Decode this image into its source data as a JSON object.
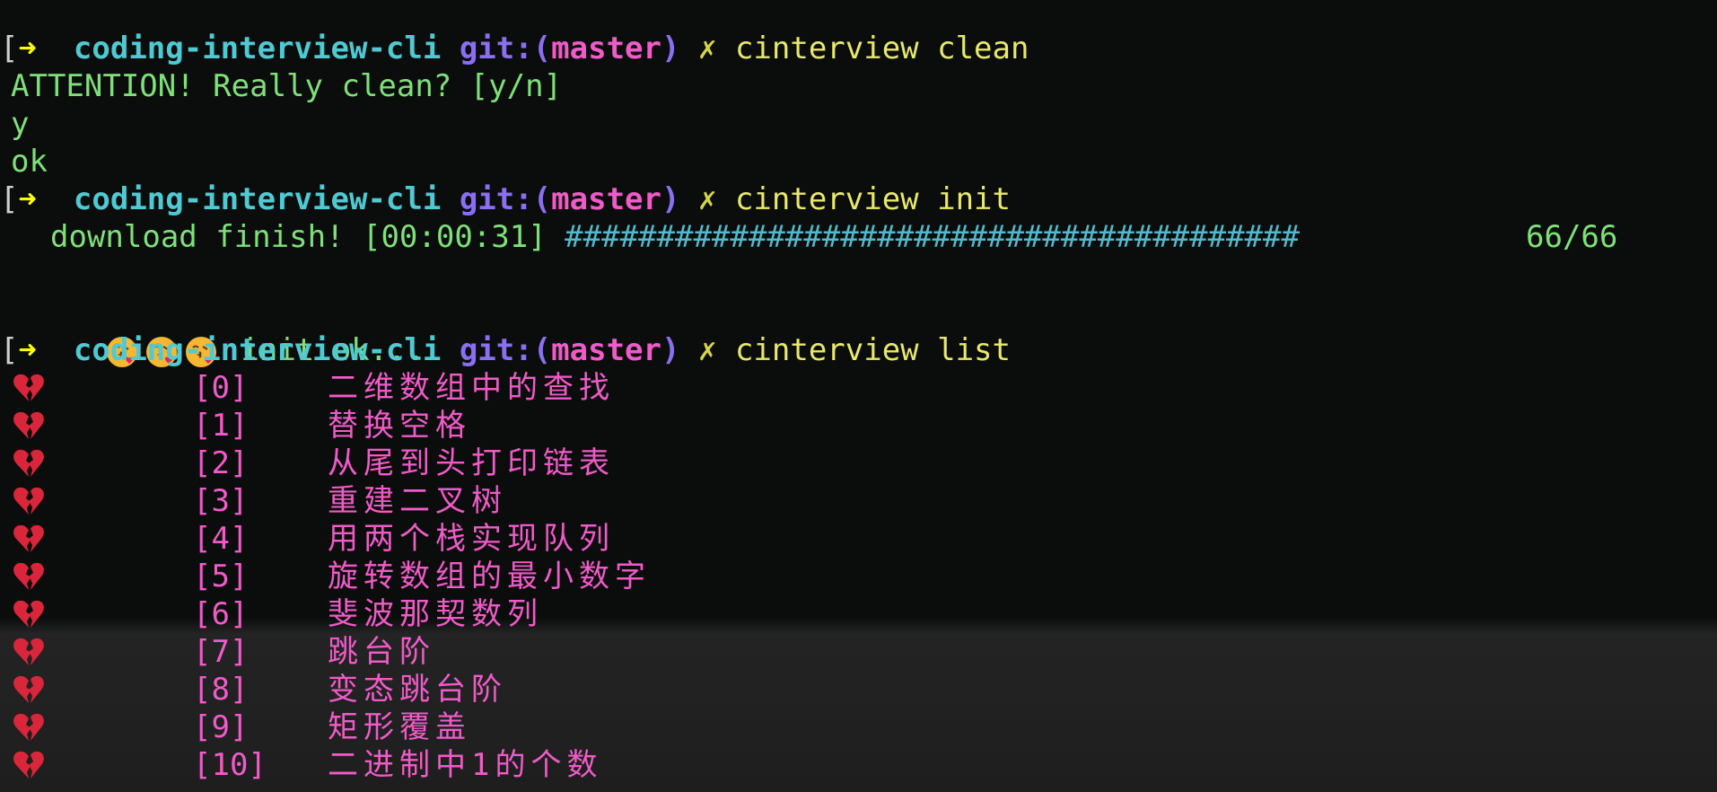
{
  "prompt": {
    "bracket": "[",
    "arrow": "➜",
    "cwd": "coding-interview-cli",
    "git_label": "git:(",
    "branch": "master",
    "git_close": ")",
    "dirty_mark": "✗"
  },
  "commands": {
    "clean": "cinterview clean",
    "init": "cinterview init",
    "list": "cinterview list"
  },
  "clean_output": {
    "question": "ATTENTION! Really clean? [y/n]",
    "answer": "y",
    "result": "ok"
  },
  "init_output": {
    "download_text": "download finish! [00:00:31]",
    "progress_bar": "########################################",
    "progress_count": "66/66",
    "progress_fraction": 1.0,
    "status_text": "init ok..."
  },
  "list_items": [
    {
      "index": "[0]",
      "title": "二维数组中的查找"
    },
    {
      "index": "[1]",
      "title": "替换空格"
    },
    {
      "index": "[2]",
      "title": "从尾到头打印链表"
    },
    {
      "index": "[3]",
      "title": "重建二叉树"
    },
    {
      "index": "[4]",
      "title": "用两个栈实现队列"
    },
    {
      "index": "[5]",
      "title": "旋转数组的最小数字"
    },
    {
      "index": "[6]",
      "title": "斐波那契数列"
    },
    {
      "index": "[7]",
      "title": "跳台阶"
    },
    {
      "index": "[8]",
      "title": "变态跳台阶"
    },
    {
      "index": "[9]",
      "title": "矩形覆盖"
    },
    {
      "index": "[10]",
      "title": "二进制中1的个数"
    }
  ],
  "icons": {
    "status_emoji": "kissing-face-heart-icon",
    "list_marker": "broken-heart-icon"
  },
  "colors": {
    "prompt_arrow": "#ffff00",
    "cwd": "#4fc9d2",
    "git": "#8a6ff2",
    "branch": "#f05bc8",
    "command": "#e8e86a",
    "output": "#7fe07a",
    "list_text": "#f05bc8"
  }
}
